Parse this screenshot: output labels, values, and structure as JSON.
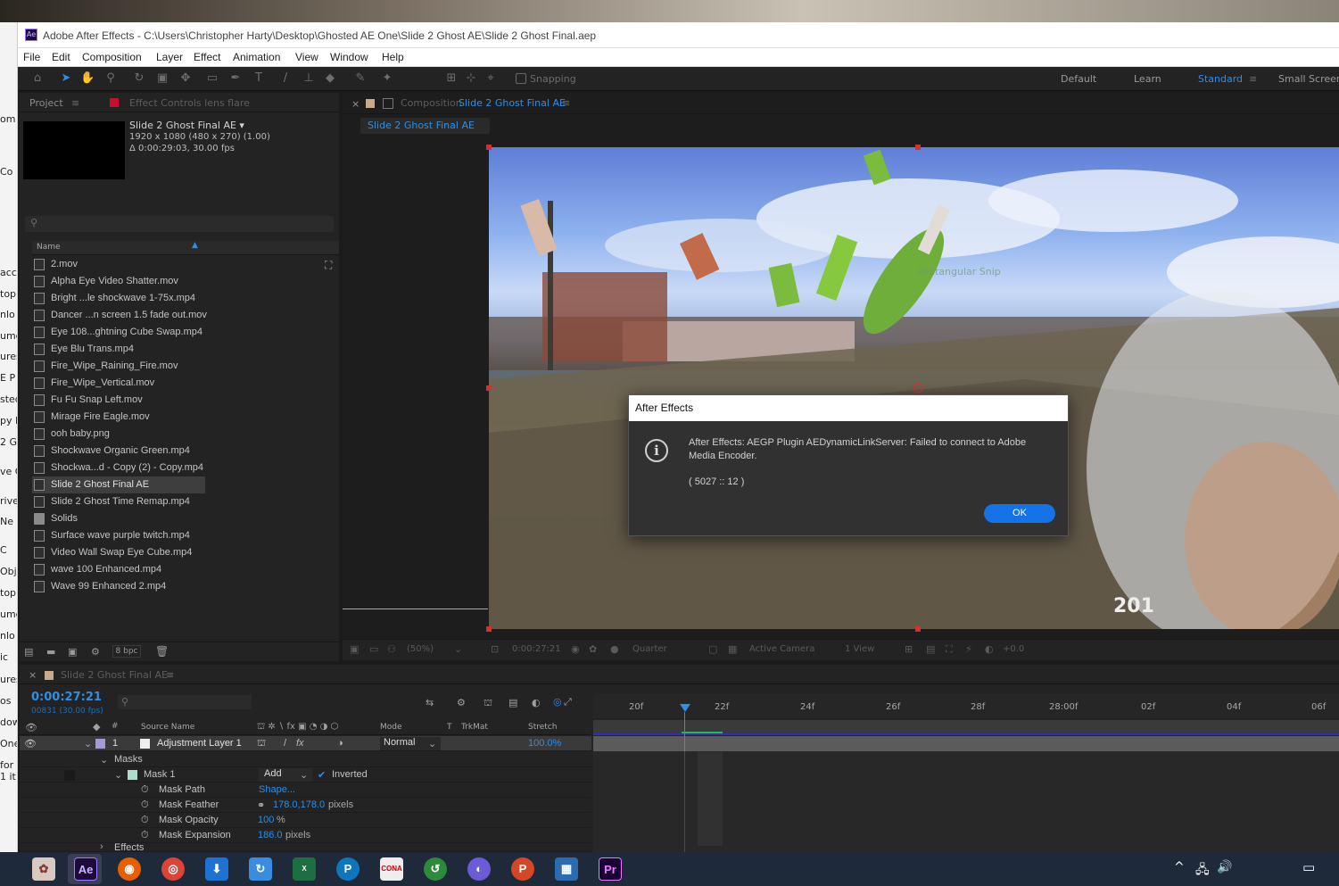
{
  "window": {
    "title": "Adobe After Effects - C:\\Users\\Christopher Harty\\Desktop\\Ghosted AE One\\Slide 2 Ghost AE\\Slide 2 Ghost Final.aep",
    "app_icon": "Ae"
  },
  "menu": [
    "File",
    "Edit",
    "Composition",
    "Layer",
    "Effect",
    "Animation",
    "View",
    "Window",
    "Help"
  ],
  "toolbar": {
    "snapping_label": "Snapping",
    "workspaces": [
      "Default",
      "Learn",
      "Standard",
      "Small Screen"
    ],
    "active_workspace": "Standard"
  },
  "left_strip": [
    "om",
    "Co",
    "acc",
    "top",
    "nlo",
    "ume",
    "ures",
    "E P",
    "sted",
    "py E",
    "2 G",
    "ve C",
    "rive",
    "Ne",
    "C",
    "Obje",
    "top",
    "ume",
    "nlo",
    "ic",
    "ures",
    "os",
    "dow",
    "One",
    "for V",
    "1 it"
  ],
  "project": {
    "tab_project": "Project",
    "tab_effect_controls": "Effect Controls lens flare",
    "comp_name": "Slide 2 Ghost Final AE ▾",
    "comp_dims": "1920 x 1080  (480 x 270) (1.00)",
    "comp_duration": "Δ 0:00:29:03, 30.00 fps",
    "column_name": "Name",
    "bpc": "8 bpc",
    "files": [
      {
        "name": "2.mov",
        "type": "file"
      },
      {
        "name": "Alpha Eye Video Shatter.mov",
        "type": "file"
      },
      {
        "name": "Bright ...le shockwave 1-75x.mp4",
        "type": "file"
      },
      {
        "name": "Dancer ...n screen 1.5 fade out.mov",
        "type": "file"
      },
      {
        "name": "Eye 108...ghtning Cube Swap.mp4",
        "type": "file"
      },
      {
        "name": "Eye Blu Trans.mp4",
        "type": "file"
      },
      {
        "name": "Fire_Wipe_Raining_Fire.mov",
        "type": "file"
      },
      {
        "name": "Fire_Wipe_Vertical.mov",
        "type": "file"
      },
      {
        "name": "Fu Fu Snap Left.mov",
        "type": "file"
      },
      {
        "name": "Mirage Fire Eagle.mov",
        "type": "file"
      },
      {
        "name": "ooh baby.png",
        "type": "file"
      },
      {
        "name": "Shockwave Organic Green.mp4",
        "type": "file"
      },
      {
        "name": "Shockwa...d - Copy (2) - Copy.mp4",
        "type": "file"
      },
      {
        "name": "Slide 2 Ghost Final AE",
        "type": "comp",
        "selected": true
      },
      {
        "name": "Slide 2 Ghost Time Remap.mp4",
        "type": "file"
      },
      {
        "name": "Solids",
        "type": "folder"
      },
      {
        "name": "Surface wave purple twitch.mp4",
        "type": "file"
      },
      {
        "name": "Video Wall Swap Eye Cube.mp4",
        "type": "file"
      },
      {
        "name": "wave 100 Enhanced.mp4",
        "type": "file"
      },
      {
        "name": "Wave 99 Enhanced 2.mp4",
        "type": "file"
      }
    ]
  },
  "composition": {
    "tab_label": "Composition",
    "tab_comp_name": "Slide 2 Ghost Final AE",
    "flow_tab": "Slide 2 Ghost Final AE",
    "watermark_text": "Rectangular Snip",
    "corner_text": "201",
    "footer": {
      "zoom": "(50%)",
      "timecode": "0:00:27:21",
      "resolution": "Quarter",
      "camera": "Active Camera",
      "views": "1 View",
      "exposure": "+0.0"
    }
  },
  "dialog": {
    "title": "After Effects",
    "message": "After Effects: AEGP Plugin AEDynamicLinkServer: Failed to connect to Adobe Media Encoder.",
    "code": "( 5027 :: 12 )",
    "ok_label": "OK"
  },
  "timeline": {
    "tab_label": "Slide 2 Ghost Final AE",
    "current_time": "0:00:27:21",
    "frame_info": "00831 (30.00 fps)",
    "col_source_name": "Source Name",
    "col_mode": "Mode",
    "col_t": "T",
    "col_trkmat": "TrkMat",
    "col_stretch": "Stretch",
    "layer": {
      "number": "1",
      "name": "Adjustment Layer 1",
      "mode": "Normal",
      "stretch": "100.0%"
    },
    "masks_label": "Masks",
    "mask1": {
      "name": "Mask 1",
      "mode": "Add",
      "inverted": "Inverted"
    },
    "properties": [
      {
        "name": "Mask Path",
        "value": "Shape...",
        "unit": ""
      },
      {
        "name": "Mask Feather",
        "value": "178.0,178.0",
        "unit": "pixels"
      },
      {
        "name": "Mask Opacity",
        "value": "100",
        "unit": "%"
      },
      {
        "name": "Mask Expansion",
        "value": "186.0",
        "unit": "pixels"
      }
    ],
    "effects_label": "Effects",
    "ruler": [
      "20f",
      "22f",
      "24f",
      "26f",
      "28f",
      "28:00f",
      "02f",
      "04f",
      "06f"
    ]
  },
  "taskbar": {
    "apps": [
      "paint-icon",
      "ae-icon",
      "firefox-icon",
      "chrome-icon",
      "download-icon",
      "sync-icon",
      "excel-icon",
      "p-icon",
      "cona-icon",
      "green-icon",
      "purple-icon",
      "powerpoint-icon",
      "calc-icon",
      "premiere-icon"
    ]
  },
  "colors": {
    "accent_blue": "#2e8fe4",
    "ok_button": "#1473e6",
    "ae_purple": "#9a7cff"
  }
}
